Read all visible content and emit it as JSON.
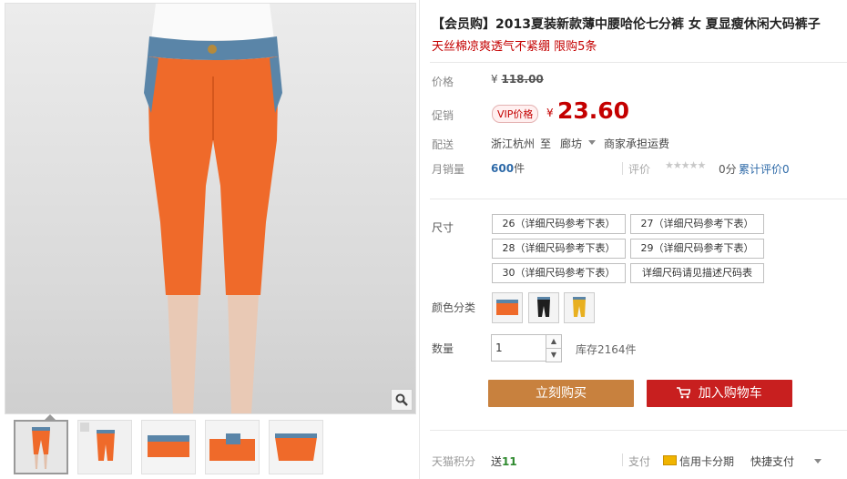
{
  "product": {
    "title": "【会员购】2013夏装新款薄中腰哈伦七分裤 女 夏显瘦休闲大码裤子",
    "subtitle": "天丝棉凉爽透气不紧绷 限购5条"
  },
  "price": {
    "label": "价格",
    "currency": "¥",
    "original": "118.00"
  },
  "promo": {
    "label": "促销",
    "badge": "VIP价格",
    "currency": "¥",
    "value": "23.60"
  },
  "shipping": {
    "label": "配送",
    "from": "浙江杭州",
    "to_word": "至",
    "to_city": "廊坊",
    "note": "商家承担运费"
  },
  "sales": {
    "label": "月销量",
    "count": "600",
    "unit": "件",
    "rating_label": "评价",
    "stars": "★★★★★",
    "score": "0分",
    "review_text": "累计评价0"
  },
  "size": {
    "label": "尺寸",
    "options": [
      "26（详细尺码参考下表）",
      "27（详细尺码参考下表）",
      "28（详细尺码参考下表）",
      "29（详细尺码参考下表）",
      "30（详细尺码参考下表）",
      "详细尺码请见描述尺码表"
    ]
  },
  "color": {
    "label": "颜色分类",
    "swatches": [
      "orange",
      "black",
      "yellow"
    ]
  },
  "quantity": {
    "label": "数量",
    "value": "1",
    "stock": "库存2164件"
  },
  "actions": {
    "buy_now": "立刻购买",
    "add_to_cart": "加入购物车"
  },
  "points": {
    "label": "天猫积分",
    "prefix": "送",
    "value": "11"
  },
  "payment": {
    "label": "支付",
    "credit": "信用卡分期",
    "quick": "快捷支付"
  },
  "colors": {
    "accent_red": "#c40000",
    "buy_button": "#c8813e",
    "cart_button": "#c81f1f",
    "link_blue": "#2e6aa8"
  },
  "icons": [
    "search-zoom-icon",
    "cart-icon",
    "credit-card-icon",
    "chevron-down-icon"
  ]
}
